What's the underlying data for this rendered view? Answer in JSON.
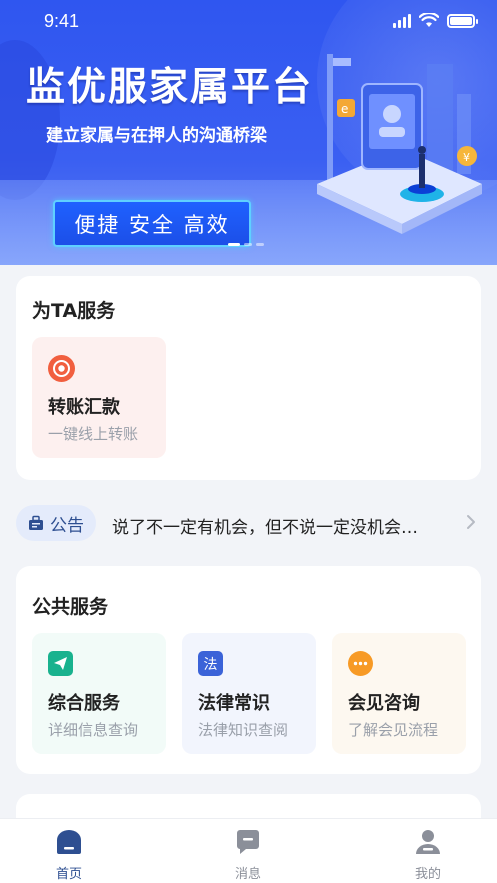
{
  "status_bar": {
    "time": "9:41"
  },
  "banner": {
    "title": "监优服家属平台",
    "subtitle": "建立家属与在押人的沟通桥梁",
    "tags": "便捷 安全 高效",
    "carousel_active_index": 0,
    "carousel_count": 3
  },
  "ta_service": {
    "title": "为TA服务",
    "items": [
      {
        "name": "转账汇款",
        "desc": "一键线上转账",
        "icon": "target-icon",
        "color": "#f15f3f"
      }
    ]
  },
  "notice": {
    "badge": "公告",
    "text": "说了不一定有机会，但不说一定没机会…"
  },
  "public_service": {
    "title": "公共服务",
    "items": [
      {
        "name": "综合服务",
        "desc": "详细信息查询",
        "icon": "send-icon",
        "color": "#19b28e"
      },
      {
        "name": "法律常识",
        "desc": "法律知识查阅",
        "icon": "law-icon",
        "icon_text": "法",
        "color": "#3b63d8"
      },
      {
        "name": "会见咨询",
        "desc": "了解会见流程",
        "icon": "chat-dots-icon",
        "color": "#f79a25"
      }
    ]
  },
  "tabbar": {
    "items": [
      {
        "label": "首页",
        "icon": "home-icon",
        "active": true
      },
      {
        "label": "消息",
        "icon": "message-icon",
        "active": false
      },
      {
        "label": "我的",
        "icon": "user-icon",
        "active": false
      }
    ]
  },
  "colors": {
    "brand": "#2f56f0",
    "active_tab": "#2e4f91"
  }
}
